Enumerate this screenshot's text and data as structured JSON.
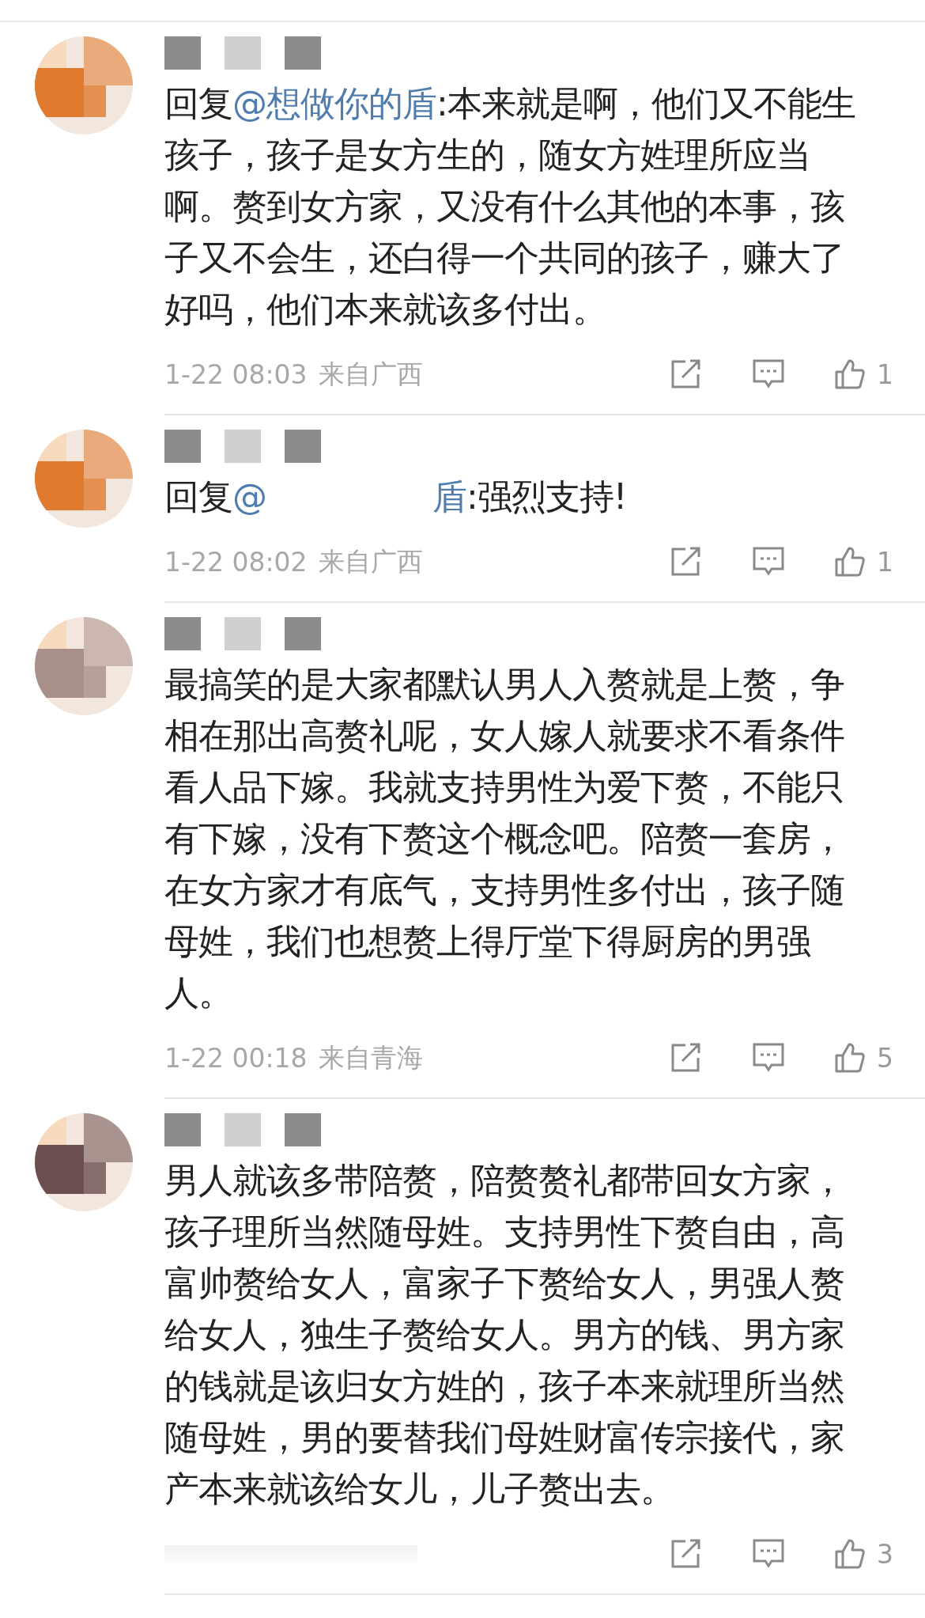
{
  "comments": [
    {
      "kind": "reply",
      "reply_label": "回复",
      "mention": "@想做你的盾",
      "text": ":本来就是啊，他们又不能生孩子，孩子是女方生的，随女方姓理所应当啊。赘到女方家，又没有什么其他的本事，孩子又不会生，还白得一个共同的孩子，赚大了好吗，他们本来就该多付出。",
      "time": "1-22 08:03",
      "location": "来自广西",
      "likes": "1"
    },
    {
      "kind": "reply",
      "reply_label": "回复",
      "mention": "@",
      "mention_tail": "盾",
      "text": ":强烈支持!",
      "time": "1-22 08:02",
      "location": "来自广西",
      "likes": "1"
    },
    {
      "kind": "plain",
      "text": "最搞笑的是大家都默认男人入赘就是上赘，争相在那出高赘礼呢，女人嫁人就要求不看条件看人品下嫁。我就支持男性为爱下赘，不能只有下嫁，没有下赘这个概念吧。陪赘一套房，在女方家才有底气，支持男性多付出，孩子随母姓，我们也想赘上得厅堂下得厨房的男强人。",
      "time": "1-22 00:18",
      "location": "来自青海",
      "likes": "5"
    },
    {
      "kind": "plain",
      "text": "男人就该多带陪赘，陪赘赘礼都带回女方家，孩子理所当然随母姓。支持男性下赘自由，高富帅赘给女人，富家子下赘给女人，男强人赘给女人，独生子赘给女人。男方的钱、男方家的钱就是该归女方姓的，孩子本来就理所当然随母姓，男的要替我们母姓财富传宗接代，家产本来就该给女儿，儿子赘出去。",
      "likes": "3"
    }
  ]
}
